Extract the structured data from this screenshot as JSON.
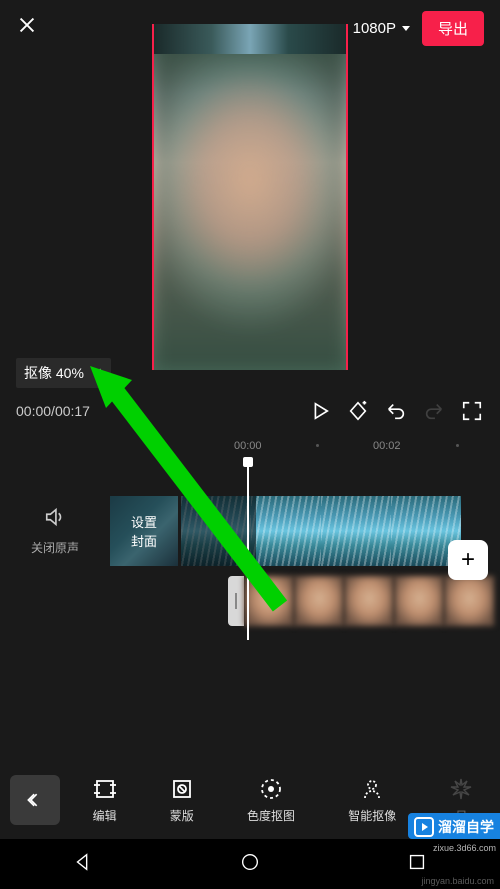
{
  "header": {
    "resolution": "1080P",
    "export_label": "导出"
  },
  "progress": {
    "label": "抠像 40%"
  },
  "playback": {
    "current_time": "00:00",
    "total_time": "00:17"
  },
  "ruler": {
    "t0": "00:00",
    "t1": "00:02"
  },
  "tracks": {
    "mute_label": "关闭原声",
    "cover_line1": "设置",
    "cover_line2": "封面"
  },
  "toolbar": {
    "items": [
      {
        "id": "edit",
        "label": "编辑"
      },
      {
        "id": "mask",
        "label": "蒙版"
      },
      {
        "id": "chroma",
        "label": "色度抠图"
      },
      {
        "id": "smart-cutout",
        "label": "智能抠像"
      },
      {
        "id": "sun",
        "label": "日"
      }
    ]
  },
  "watermark": {
    "brand": "溜溜自学",
    "url": "zixue.3d66.com",
    "source": "jingyan.baidu.com"
  },
  "colors": {
    "accent": "#f7204a"
  }
}
